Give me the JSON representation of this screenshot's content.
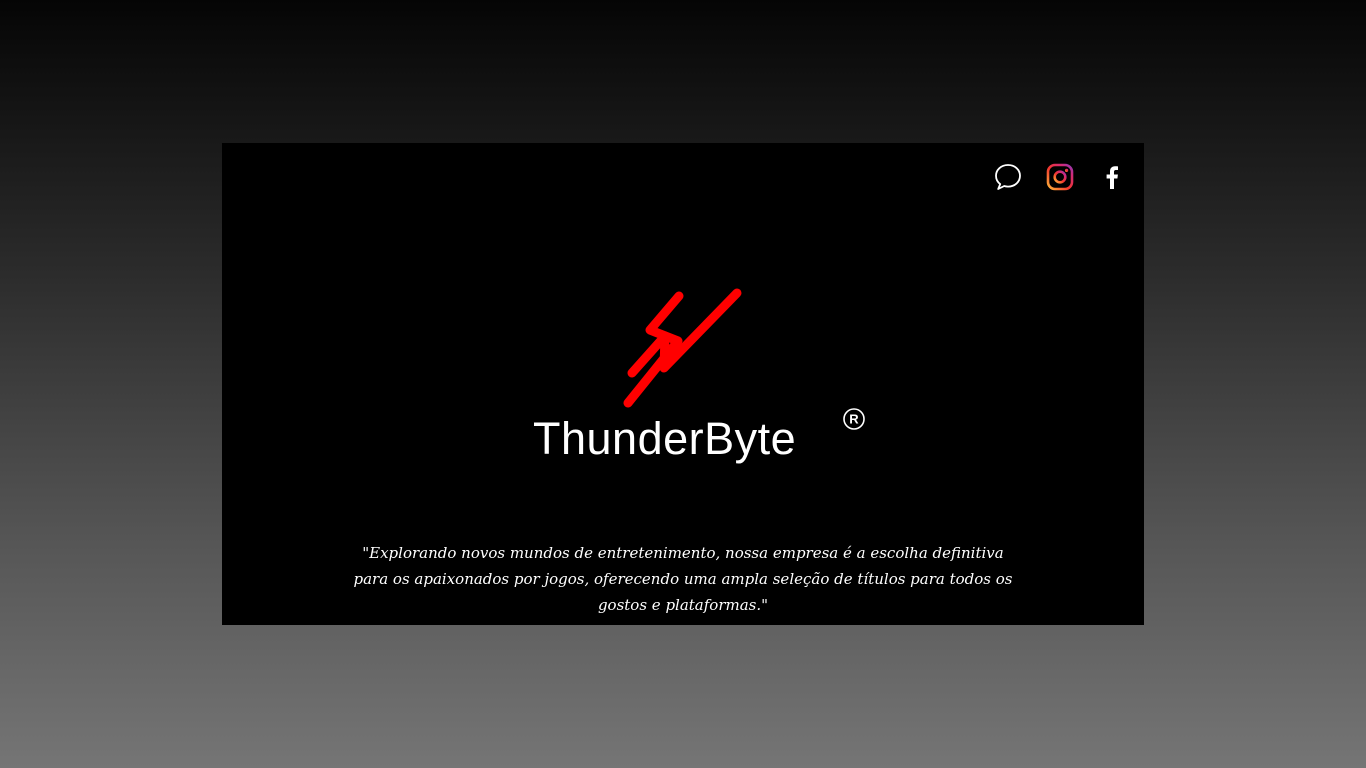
{
  "brand": {
    "name": "ThunderByte",
    "logo_icon": "thunderbyte-bolt-logo",
    "logo_color": "#ff0000",
    "registered_icon": "registered-trademark-icon"
  },
  "social": [
    {
      "icon": "chat-bubble-icon",
      "label": "Chat"
    },
    {
      "icon": "instagram-icon",
      "label": "Instagram"
    },
    {
      "icon": "facebook-icon",
      "label": "Facebook"
    }
  ],
  "tagline": "\"Explorando novos mundos de entretenimento, nossa empresa é a escolha definitiva para os apaixonados por jogos, oferecendo uma ampla seleção de títulos para todos os gostos e plataformas.\"",
  "colors": {
    "card_background": "#000000",
    "text": "#ffffff",
    "accent": "#ff0000"
  }
}
